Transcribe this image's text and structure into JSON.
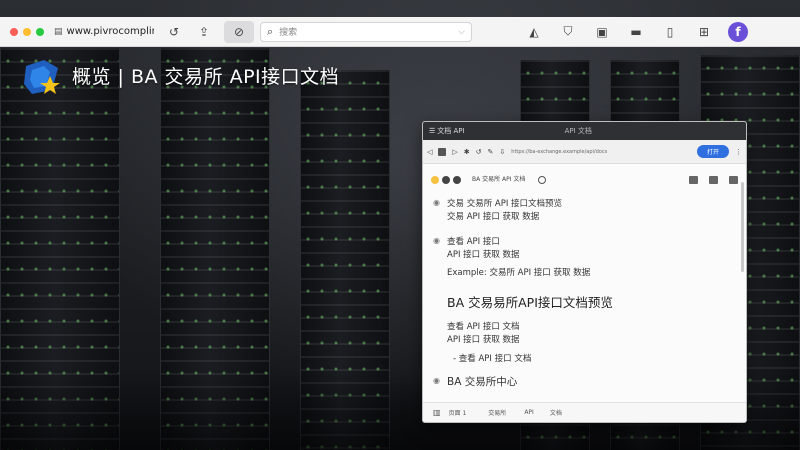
{
  "browser": {
    "url": "www.pivrocomplinis",
    "search_placeholder": "搜索",
    "traffic_colors": [
      "#ff5f57",
      "#febc2e",
      "#28c840"
    ],
    "avatar_letter": "f",
    "avatar_color": "#6b4fd8"
  },
  "heading": {
    "title": "概览 | BA  交易所  API接口文档"
  },
  "inner_window": {
    "titlebar_text": "文档 API",
    "window_title": "API 文档",
    "address_text": "https://ba-exchange.example/api/docs",
    "primary_button": "打开",
    "subtitle": "BA 交易所 API 文档",
    "items": [
      {
        "title": "交易  交易所 API 接口文档预览",
        "detail": "交易 API 接口 获取 数据"
      },
      {
        "title": "查看 API 接口",
        "detail": "API 接口 获取 数据",
        "extra": "Example: 交易所 API 接口 获取 数据"
      },
      {
        "title": "BA 交易易所API接口文档预览",
        "big": true
      },
      {
        "title": "查看 API 接口 文档",
        "detail": "API 接口 获取 数据"
      },
      {
        "title": "- 查看 API 接口 文档",
        "indent": true
      },
      {
        "title": "BA 交易所中心",
        "big_small": true
      }
    ],
    "footer_items": [
      "页面 1",
      "交易所",
      "API",
      "文档"
    ]
  }
}
